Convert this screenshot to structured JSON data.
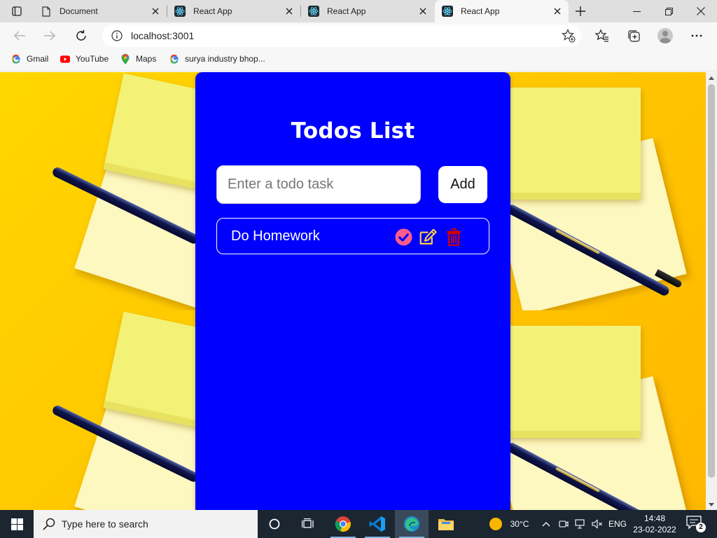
{
  "browser": {
    "tabs": [
      {
        "title": "Document",
        "favicon": "document-icon",
        "active": false
      },
      {
        "title": "React App",
        "favicon": "react-icon",
        "active": false
      },
      {
        "title": "React App",
        "favicon": "react-icon",
        "active": false
      },
      {
        "title": "React App",
        "favicon": "react-icon",
        "active": true
      }
    ],
    "address": {
      "url": "localhost:3001"
    },
    "favorites": [
      {
        "label": "Gmail",
        "icon": "google-icon"
      },
      {
        "label": "YouTube",
        "icon": "youtube-icon"
      },
      {
        "label": "Maps",
        "icon": "maps-pin-icon"
      },
      {
        "label": "surya industry bhop...",
        "icon": "google-icon"
      }
    ]
  },
  "app": {
    "title": "Todos List",
    "input": {
      "placeholder": "Enter a todo task",
      "value": ""
    },
    "add_label": "Add",
    "todos": [
      {
        "text": "Do Homework"
      }
    ],
    "colors": {
      "card": "#0000ff",
      "complete_icon": "#ff5c8a",
      "edit_icon": "#ffd23f",
      "delete_icon": "#d10000"
    }
  },
  "taskbar": {
    "search_placeholder": "Type here to search",
    "weather": "30°C",
    "language": "ENG",
    "time": "14:48",
    "date": "23-02-2022",
    "notification_count": "2"
  }
}
